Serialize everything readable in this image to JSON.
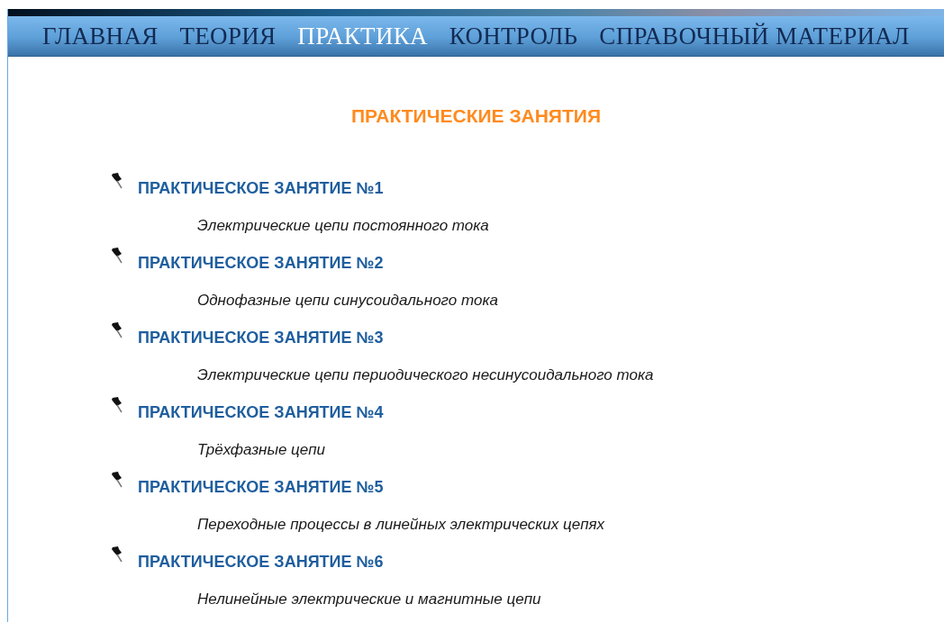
{
  "nav": [
    {
      "label": "ГЛАВНАЯ",
      "selected": false
    },
    {
      "label": "ТЕОРИЯ",
      "selected": false
    },
    {
      "label": "ПРАКТИКА",
      "selected": true
    },
    {
      "label": "КОНТРОЛЬ",
      "selected": false
    },
    {
      "label": "СПРАВОЧНЫЙ МАТЕРИАЛ",
      "selected": false
    }
  ],
  "heading": "ПРАКТИЧЕСКИЕ ЗАНЯТИЯ",
  "lessons": [
    {
      "title": "ПРАКТИЧЕСКОЕ ЗАНЯТИЕ №1",
      "description": "Электрические цепи постоянного тока"
    },
    {
      "title": "ПРАКТИЧЕСКОЕ ЗАНЯТИЕ №2",
      "description": "Однофазные цепи синусоидального тока"
    },
    {
      "title": "ПРАКТИЧЕСКОЕ ЗАНЯТИЕ №3",
      "description": "Электрические цепи периодического несинусоидального тока"
    },
    {
      "title": "ПРАКТИЧЕСКОЕ ЗАНЯТИЕ №4",
      "description": "Трёхфазные цепи"
    },
    {
      "title": "ПРАКТИЧЕСКОЕ ЗАНЯТИЕ №5",
      "description": "Переходные процессы в линейных электрических цепях"
    },
    {
      "title": "ПРАКТИЧЕСКОЕ ЗАНЯТИЕ №6",
      "description": "Нелинейные электрические и магнитные цепи"
    }
  ]
}
